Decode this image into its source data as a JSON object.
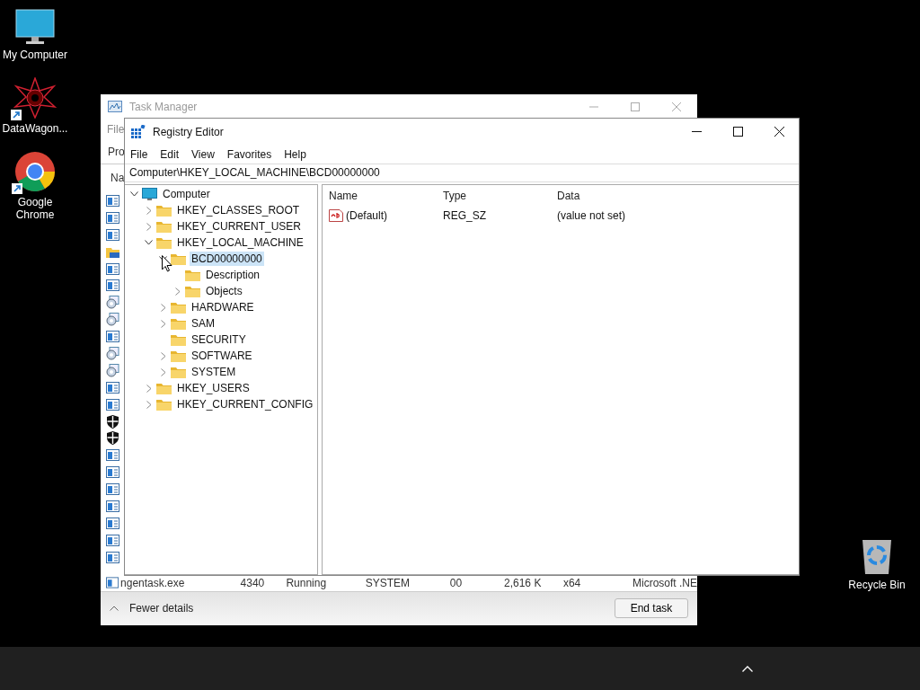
{
  "desktop_icons": [
    {
      "kind": "monitor",
      "label": "My Computer"
    },
    {
      "kind": "star",
      "label": "DataWagon...",
      "shortcut": true
    },
    {
      "kind": "browser",
      "label": "Google Chrome",
      "shortcut": true
    },
    {
      "kind": "bin",
      "label": "Recycle Bin"
    }
  ],
  "task_manager": {
    "title": "Task Manager",
    "menu": [
      "File"
    ],
    "tab": "Pro",
    "column": "Na",
    "rows": [
      {
        "kind": "app"
      },
      {
        "kind": "app"
      },
      {
        "kind": "app"
      },
      {
        "kind": "folder"
      },
      {
        "kind": "app"
      },
      {
        "kind": "app"
      },
      {
        "kind": "service"
      },
      {
        "kind": "service"
      },
      {
        "kind": "app"
      },
      {
        "kind": "service"
      },
      {
        "kind": "service"
      },
      {
        "kind": "app"
      },
      {
        "kind": "app"
      },
      {
        "kind": "shield"
      },
      {
        "kind": "shield"
      },
      {
        "kind": "app"
      },
      {
        "kind": "app"
      },
      {
        "kind": "app"
      },
      {
        "kind": "app"
      },
      {
        "kind": "app"
      },
      {
        "kind": "app"
      },
      {
        "kind": "app"
      }
    ],
    "last_row": [
      "ngentask.exe",
      "4340",
      "Running",
      "SYSTEM",
      "00",
      "2,616 K",
      "x64",
      "Microsoft .NE"
    ],
    "fewer_details": "Fewer details",
    "end_task": "End task"
  },
  "registry_editor": {
    "title": "Registry Editor",
    "menu": [
      "File",
      "Edit",
      "View",
      "Favorites",
      "Help"
    ],
    "address": "Computer\\HKEY_LOCAL_MACHINE\\BCD00000000",
    "tree": [
      {
        "label": "Computer",
        "kind": "computer",
        "expanded": true,
        "selected": false,
        "children": [
          {
            "label": "HKEY_CLASSES_ROOT",
            "expanded": false,
            "selected": false
          },
          {
            "label": "HKEY_CURRENT_USER",
            "expanded": false,
            "selected": false
          },
          {
            "label": "HKEY_LOCAL_MACHINE",
            "expanded": true,
            "selected": false,
            "children": [
              {
                "label": "BCD00000000",
                "expanded": true,
                "selected": true,
                "children": [
                  {
                    "label": "Description",
                    "selected": false
                  },
                  {
                    "label": "Objects",
                    "expanded": false,
                    "selected": false
                  }
                ]
              },
              {
                "label": "HARDWARE",
                "expanded": false,
                "selected": false
              },
              {
                "label": "SAM",
                "expanded": false,
                "selected": false
              },
              {
                "label": "SECURITY",
                "selected": false
              },
              {
                "label": "SOFTWARE",
                "expanded": false,
                "selected": false
              },
              {
                "label": "SYSTEM",
                "expanded": false,
                "selected": false
              }
            ]
          },
          {
            "label": "HKEY_USERS",
            "expanded": false,
            "selected": false
          },
          {
            "label": "HKEY_CURRENT_CONFIG",
            "expanded": false,
            "selected": false
          }
        ]
      }
    ],
    "columns": [
      "Name",
      "Type",
      "Data"
    ],
    "values": [
      {
        "name": "(Default)",
        "type": "REG_SZ",
        "data": "(value not set)"
      }
    ]
  }
}
